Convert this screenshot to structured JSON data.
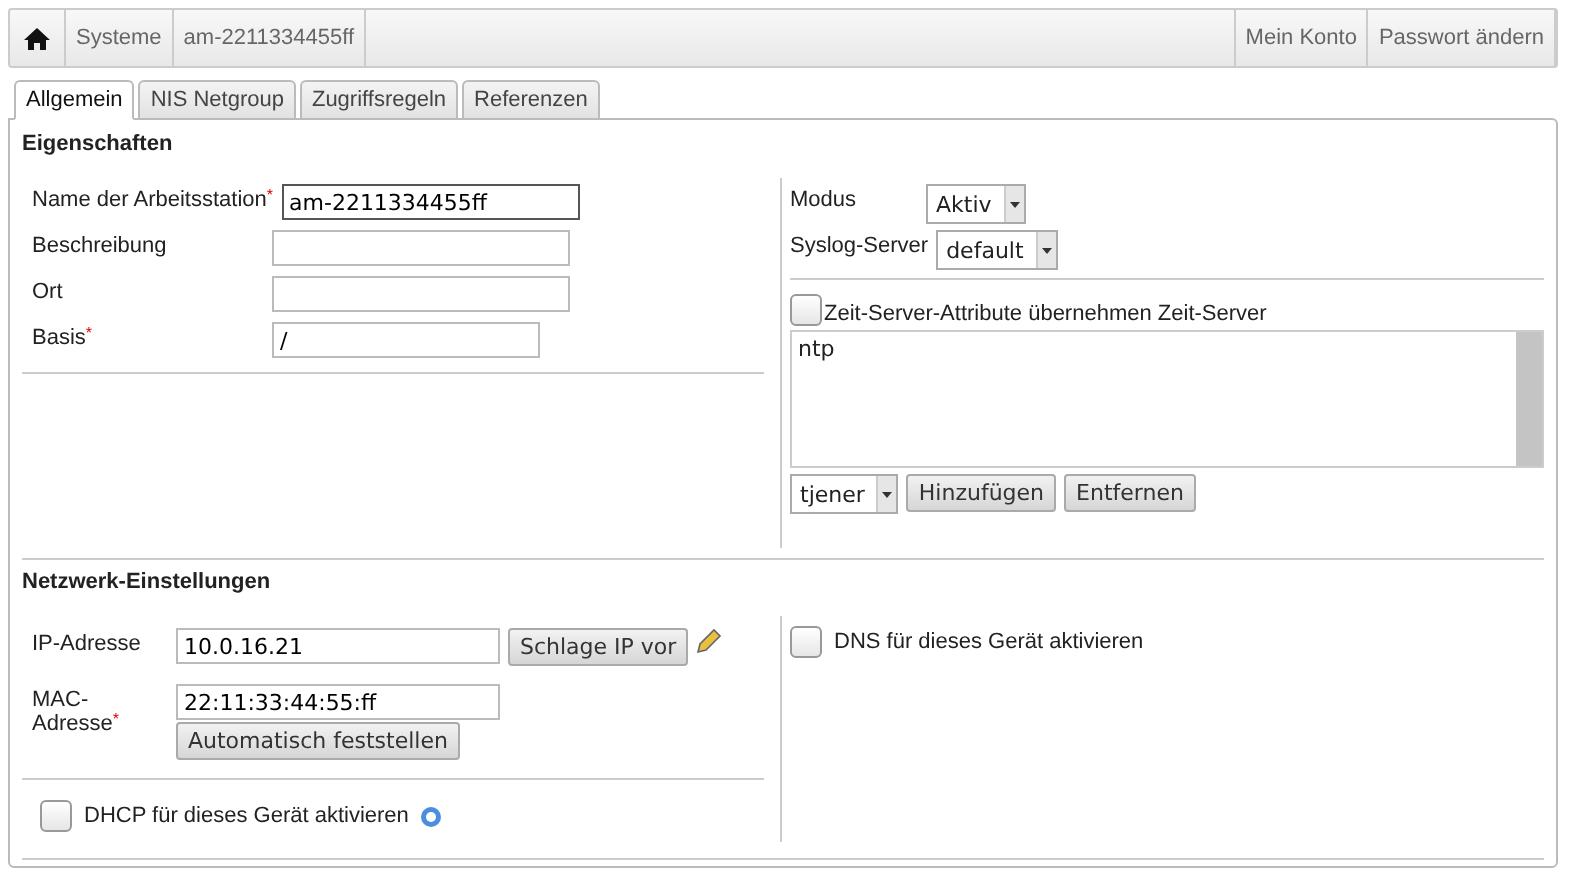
{
  "breadcrumb": {
    "items": [
      "Systeme",
      "am-2211334455ff"
    ],
    "links": [
      "Mein Konto",
      "Passwort ändern"
    ]
  },
  "tabs": [
    {
      "label": "Allgemein",
      "selected": true
    },
    {
      "label": "NIS Netgroup",
      "selected": false
    },
    {
      "label": "Zugriffsregeln",
      "selected": false
    },
    {
      "label": "Referenzen",
      "selected": false
    }
  ],
  "properties": {
    "heading": "Eigenschaften",
    "fields": [
      {
        "label": "Name der Arbeitsstation$^{*}$",
        "value": "am-2211334455ff",
        "focused": true
      },
      {
        "label": "Beschreibung",
        "focused": false
      },
      {
        "label": "Ort",
        "focused": false
      },
      {
        "label": "Basis$^{*}$",
        "value": "/",
        "focused": false
      }
    ],
    "selects": [
      {
        "label": "Modus",
        "value": "Aktiv"
      },
      {
        "label": "Syslog-Server",
        "value": "default"
      }
    ],
    "time_server": {
      "label": "Zeit-Server-Attribute übernehmen Zeit-Server",
      "checked": false,
      "entries": [
        "ntp"
      ],
      "select": "tjener",
      "buttons": [
        "Hinzufügen",
        "Entfernen"
      ]
    }
  },
  "network": {
    "heading": "Netzwerk-Einstellungen",
    "ip": {
      "label": "IP-Adresse",
      "value": "10.0.16.21",
      "button": "Schlage IP vor"
    },
    "mac": {
      "label": "MAC-Adresse$^{*}$",
      "value": "22:11:33:44:55:ff",
      "button": "Automatisch feststellen"
    },
    "dhcp": {
      "label": "DHCP für dieses Gerät aktivieren",
      "checked": false
    },
    "dns": {
      "label": "DNS für dieses Gerät aktivieren",
      "checked": false
    }
  }
}
